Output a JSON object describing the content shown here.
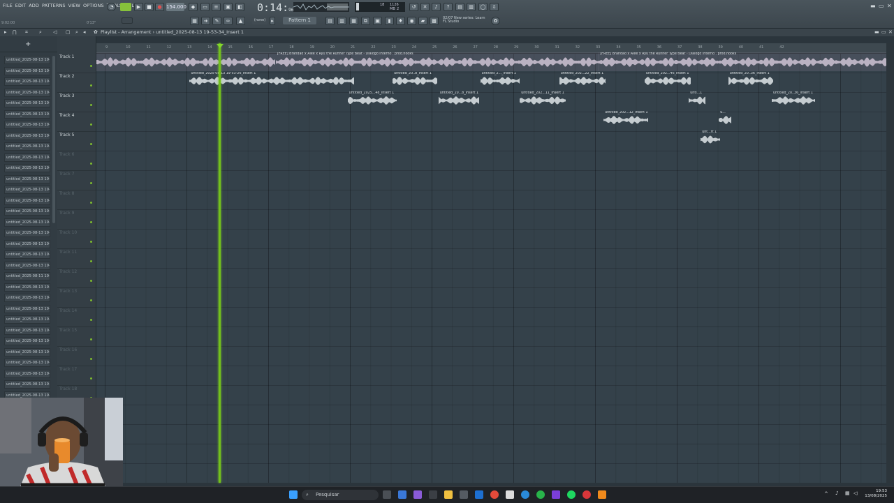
{
  "menu": [
    "FILE",
    "EDIT",
    "ADD",
    "PATTERNS",
    "VIEW",
    "OPTIONS",
    "TOOLS",
    "HELP"
  ],
  "hint_left": "9:02:00",
  "hint_mid": "0'13\"",
  "transport": {
    "tempo": "154.000",
    "time": "0:14",
    "time_frac": "96"
  },
  "cpu": {
    "ram": "1126 MB",
    "cpu_val": "18",
    "poly": "2"
  },
  "pattern_selector": "Pattern 1",
  "snap": "(none)",
  "news": {
    "line1": "02/07  New series: Learn",
    "line2": "FL Studio"
  },
  "playlist": {
    "title": "Playlist - Arrangement",
    "breadcrumb": "untitled_2025-08-13 19-53-34_Insert 1"
  },
  "browser_items": [
    "untitled_2025-08-13 19-",
    "untitled_2025-08-13 19-",
    "untitled_2025-08-13 19-",
    "untitled_2025-08-13 19-",
    "untitled_2025-08-13 19-",
    "untitled_2025-08-13 19-",
    "untitled_2025-08-13 19-",
    "untitled_2025-08-13 19-",
    "untitled_2025-08-13 19-",
    "untitled_2025-08-13 19-",
    "untitled_2025-08-13 19-",
    "untitled_2025-08-13 19-",
    "untitled_2025-08-13 19-",
    "untitled_2025-08-13 19-",
    "untitled_2025-08-13 19-",
    "untitled_2025-08-13 19-",
    "untitled_2025-08-13 19-",
    "untitled_2025-08-13 19-",
    "untitled_2025-08-13 19-",
    "untitled_2025-08-13 19-",
    "untitled_2025-08-11 19-",
    "untitled_2025-08-13 19-",
    "untitled_2025-08-13 19-",
    "untitled_2025-08-13 19-",
    "untitled_2025-08-13 19-",
    "untitled_2025-08-13 19-",
    "untitled_2025-08-13 19-",
    "untitled_2025-08-13 19-",
    "untitled_2025-08-13 19-",
    "untitled_2025-08-13 19-",
    "untitled_2025-08-13 19-",
    "untitled_2025-08-13 19-"
  ],
  "tracks": [
    "Track 1",
    "Track 2",
    "Track 3",
    "Track 4",
    "Track 5",
    "Track 6",
    "Track 7",
    "Track 8",
    "Track 9",
    "Track 10",
    "Track 11",
    "Track 12",
    "Track 13",
    "Track 14",
    "Track 15",
    "Track 16",
    "Track 17",
    "Track 18"
  ],
  "ruler_marks": [
    "9",
    "10",
    "11",
    "12",
    "13",
    "14",
    "15",
    "16",
    "17",
    "18",
    "19",
    "20",
    "21",
    "22",
    "23",
    "24",
    "25",
    "26",
    "27",
    "28",
    "29",
    "30",
    "31",
    "32",
    "33",
    "34",
    "35",
    "36",
    "37",
    "38",
    "39",
    "40",
    "41",
    "42"
  ],
  "clips": [
    {
      "track": 0,
      "start": 0.0,
      "len": 0.227,
      "name": ""
    },
    {
      "track": 0,
      "start": 0.227,
      "len": 0.41,
      "name": "[FREE] Brandão x Alee x Ryu the Runner Type Beat - Diálogo Interno . prod.nooks"
    },
    {
      "track": 0,
      "start": 0.636,
      "len": 0.425,
      "name": "[FREE] Brandão x Alee x Ryu the Runner Type Beat - Diálogo Interno . prod.nooks"
    },
    {
      "track": 1,
      "start": 0.118,
      "len": 0.21,
      "name": "untitled_2025-08-13 19-53-26_Insert 1"
    },
    {
      "track": 1,
      "start": 0.375,
      "len": 0.058,
      "name": "untitled_20..8_Insert 1"
    },
    {
      "track": 1,
      "start": 0.486,
      "len": 0.05,
      "name": "untitled_2..._Insert 1"
    },
    {
      "track": 1,
      "start": 0.586,
      "len": 0.06,
      "name": "untitled_202...22_Insert 1"
    },
    {
      "track": 1,
      "start": 0.694,
      "len": 0.06,
      "name": "untitled_202...46_Insert 1"
    },
    {
      "track": 1,
      "start": 0.8,
      "len": 0.058,
      "name": "untitled_20..36_Insert 1"
    },
    {
      "track": 2,
      "start": 0.318,
      "len": 0.062,
      "name": "untitled_2025...48_Insert 1"
    },
    {
      "track": 2,
      "start": 0.433,
      "len": 0.052,
      "name": "untitled_20...8_Insert 1"
    },
    {
      "track": 2,
      "start": 0.536,
      "len": 0.06,
      "name": "untitled_202...11_Insert 1"
    },
    {
      "track": 2,
      "start": 0.75,
      "len": 0.022,
      "name": "unti...1"
    },
    {
      "track": 2,
      "start": 0.855,
      "len": 0.055,
      "name": "untitled_20..36_Insert 1"
    },
    {
      "track": 3,
      "start": 0.642,
      "len": 0.058,
      "name": "untitled_202...12_Insert 1"
    },
    {
      "track": 3,
      "start": 0.788,
      "len": 0.016,
      "name": "u..."
    },
    {
      "track": 4,
      "start": 0.765,
      "len": 0.025,
      "name": "unt...rt 1"
    }
  ],
  "taskbar": {
    "search": "Pesquisar",
    "time": "19:53",
    "date": "13/08/2025"
  }
}
